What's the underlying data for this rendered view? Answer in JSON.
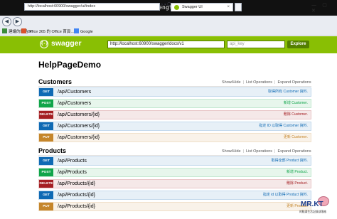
{
  "banner": {
    "url": "http://kevintsengtw.blogspot.tw",
    "separator": "-",
    "name": ""
  },
  "browser": {
    "back_icon": "arrow-left-icon",
    "forward_icon": "arrow-right-icon",
    "address": "http://localhost:60900/swagger/ui/index",
    "address_controls": "⌕ ▾ ⟳",
    "tab_title": "Swagger UI",
    "tab_close": "×",
    "window_controls": "— ▢ ✕",
    "favorites": [
      {
        "label": "建議的網站 ▾",
        "icon_color": "#3c8c3c"
      },
      {
        "label": "Office 365 的 Office 首頁...",
        "icon_color": "#d9532c"
      },
      {
        "label": "Google",
        "icon_color": "#4285f4"
      }
    ]
  },
  "header": {
    "logo_glyph": "{-}",
    "logo_text": "swagger",
    "url_value": "http://localhost:60900/swagger/docs/v1",
    "api_key_placeholder": "api_key",
    "explore_label": "Explore",
    "bg_color": "#89bf04"
  },
  "page": {
    "title": "HelpPageDemo"
  },
  "links": {
    "show_hide": "Show/Hide",
    "list_operations": "List Operations",
    "expand_operations": "Expand Operations",
    "separator": "|"
  },
  "sections": [
    {
      "name": "Customers",
      "operations": [
        {
          "method": "GET",
          "path": "/api/Customers",
          "summary": "取得所有 Customer 資料."
        },
        {
          "method": "POST",
          "path": "/api/Customers",
          "summary": "新增 Customer."
        },
        {
          "method": "DELETE",
          "path": "/api/Customers/{id}",
          "summary": "刪除 Customer."
        },
        {
          "method": "GET",
          "path": "/api/Customers/{id}",
          "summary": "指定 ID 以取得 Customer 資料."
        },
        {
          "method": "PUT",
          "path": "/api/Customers/{id}",
          "summary": "更新 Customer."
        }
      ]
    },
    {
      "name": "Products",
      "operations": [
        {
          "method": "GET",
          "path": "/api/Products",
          "summary": "取得全部 Product 資料."
        },
        {
          "method": "POST",
          "path": "/api/Products",
          "summary": "新增 Product."
        },
        {
          "method": "DELETE",
          "path": "/api/Products/{id}",
          "summary": "刪除 Product."
        },
        {
          "method": "GET",
          "path": "/api/Products/{id}",
          "summary": "指定 id 以取得 Product 資料."
        },
        {
          "method": "PUT",
          "path": "/api/Products/{id}",
          "summary": "更新 Product."
        }
      ]
    }
  ],
  "watermark": {
    "big": "MR.KT",
    "small": "的點滴生活記錄部落格"
  }
}
